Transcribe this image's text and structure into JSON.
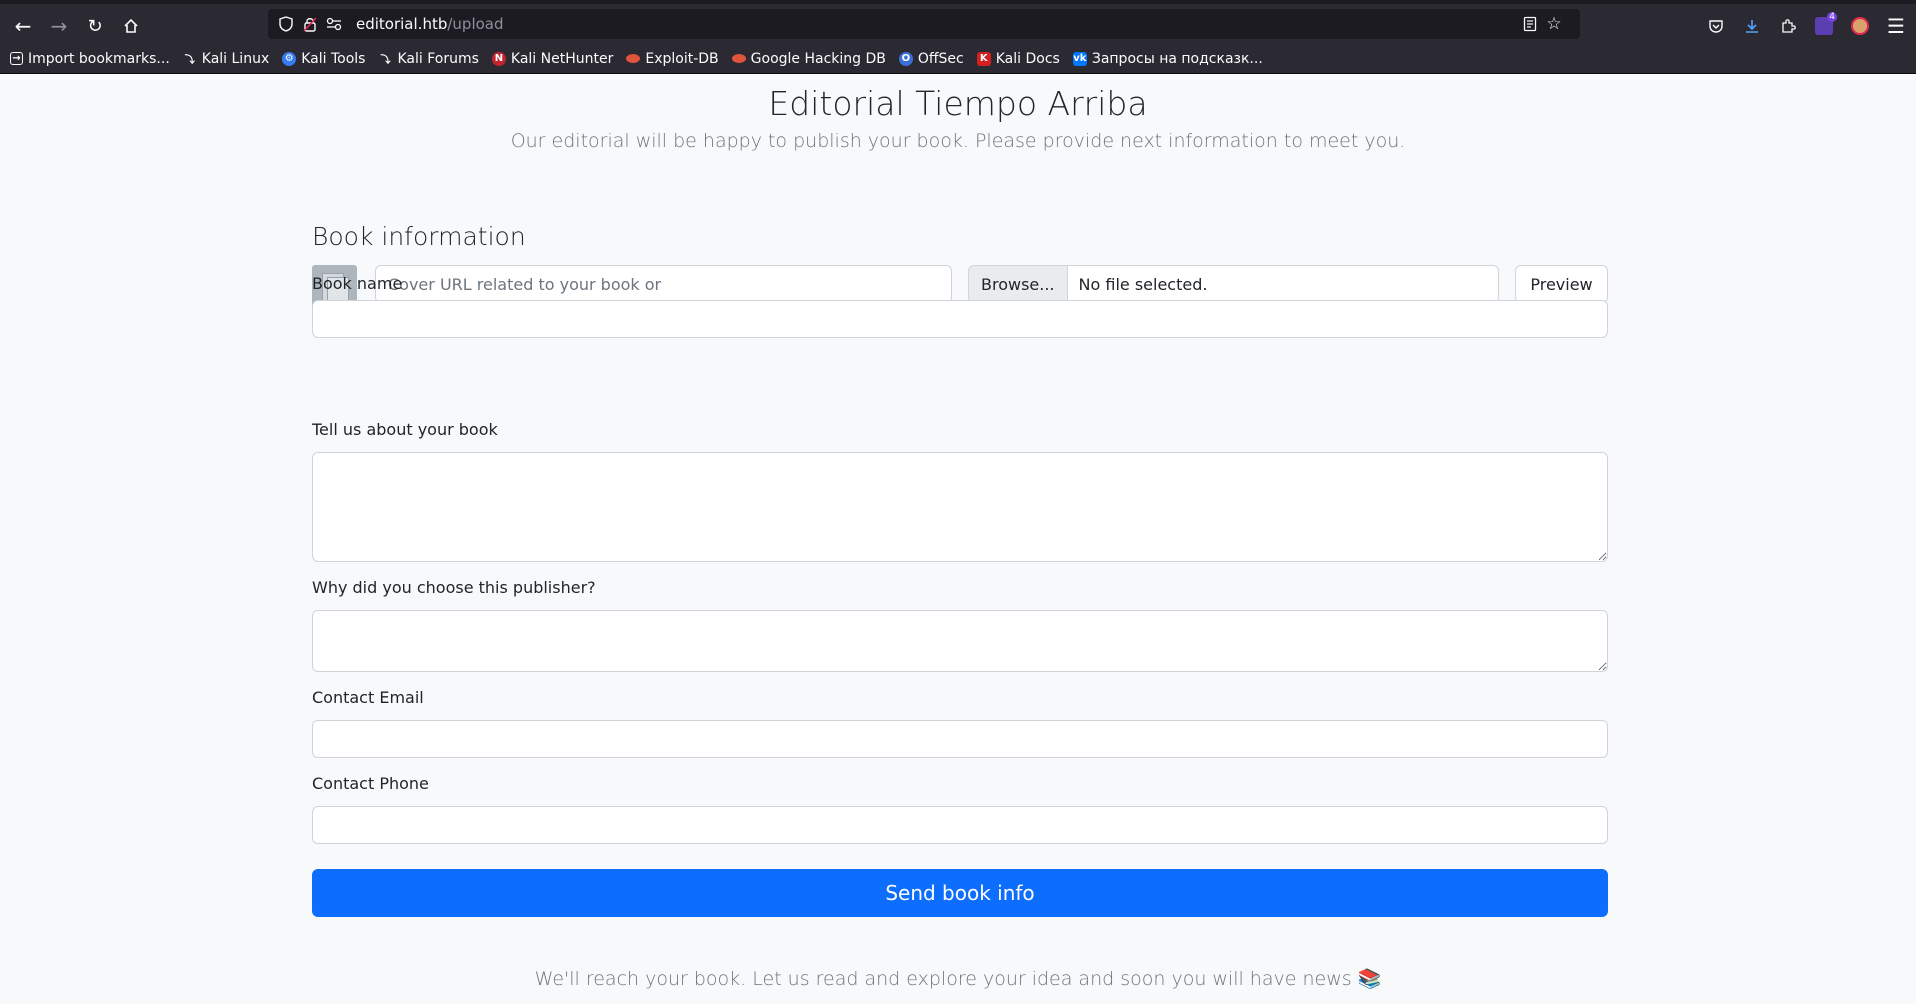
{
  "browser": {
    "url_host": "editorial.htb",
    "url_path": "/upload",
    "bookmarks": [
      {
        "label": "Import bookmarks...",
        "icon": "import-icon",
        "color": "#2b2a33"
      },
      {
        "label": "Kali Linux",
        "icon": "kali-icon",
        "color": "#2b2a33"
      },
      {
        "label": "Kali Tools",
        "icon": "kali-tools-icon",
        "color": "#367bf0"
      },
      {
        "label": "Kali Forums",
        "icon": "kali-forums-icon",
        "color": "#2b2a33"
      },
      {
        "label": "Kali NetHunter",
        "icon": "nethunter-icon",
        "color": "#c4252d"
      },
      {
        "label": "Exploit-DB",
        "icon": "exploitdb-icon",
        "color": "#e0533c"
      },
      {
        "label": "Google Hacking DB",
        "icon": "ghdb-icon",
        "color": "#e0533c"
      },
      {
        "label": "OffSec",
        "icon": "offsec-icon",
        "color": "#3a6fd8"
      },
      {
        "label": "Kali Docs",
        "icon": "kali-docs-icon",
        "color": "#d3201f"
      },
      {
        "label": "Запросы на подсказк...",
        "icon": "vk-icon",
        "color": "#0077ff"
      }
    ]
  },
  "page": {
    "title": "Editorial Tiempo Arriba",
    "subtitle": "Our editorial will be happy to publish your book. Please provide next information to meet you.",
    "section_title": "Book information",
    "cover_url_placeholder": "Cover URL related to your book or",
    "browse_label": "Browse...",
    "file_status": "No file selected.",
    "preview_label": "Preview",
    "fields": {
      "book_name": "Book name",
      "about": "Tell us about your book",
      "why": "Why did you choose this publisher?",
      "email": "Contact Email",
      "phone": "Contact Phone"
    },
    "submit_label": "Send book info",
    "footer": "We'll reach your book. Let us read and explore your idea and soon you will have news 📚"
  },
  "colors": {
    "primary": "#0d6efd",
    "browser_bg": "#2b2a33"
  }
}
